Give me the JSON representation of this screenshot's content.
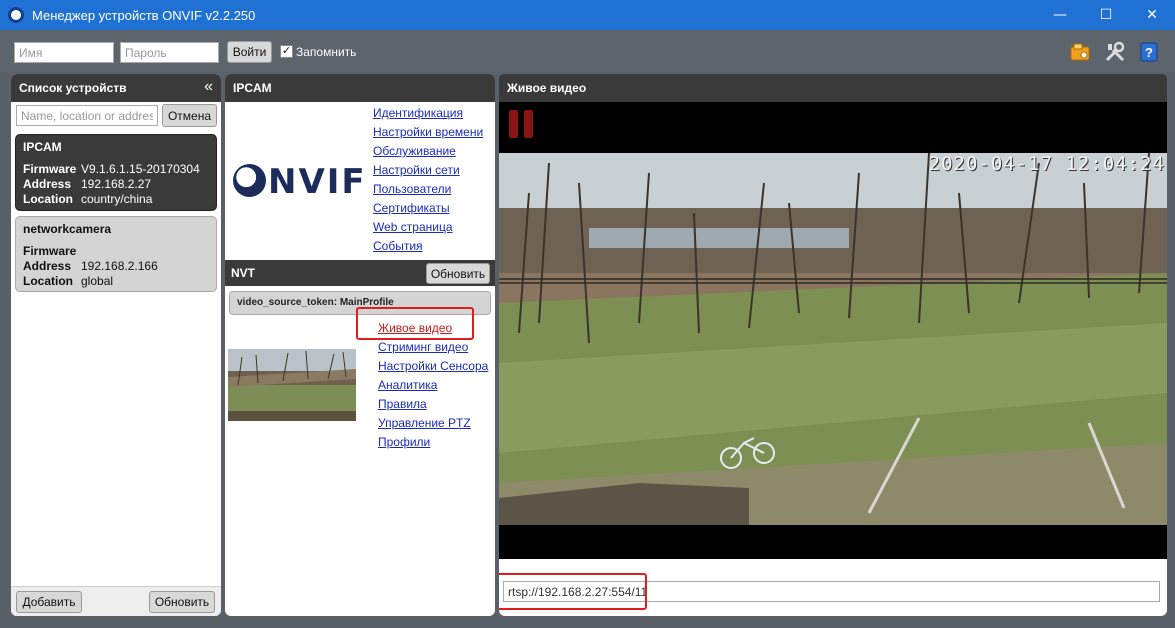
{
  "window": {
    "title": "Менеджер устройств ONVIF v2.2.250",
    "minimize": "—",
    "maximize": "☐",
    "close": "✕"
  },
  "login": {
    "user_placeholder": "Имя",
    "password_placeholder": "Пароль",
    "login_label": "Войти",
    "remember_label": "Запомнить",
    "remember_checked": "✓"
  },
  "devices": {
    "header": "Список устройств",
    "collapse_glyph": "«",
    "search_placeholder": "Name, location or address",
    "cancel_label": "Отмена",
    "items": [
      {
        "name": "IPCAM",
        "firmware_label": "Firmware",
        "firmware": "V9.1.6.1.15-20170304",
        "address_label": "Address",
        "address": "192.168.2.27",
        "location_label": "Location",
        "location": "country/china"
      },
      {
        "name": "networkcamera",
        "firmware_label": "Firmware",
        "firmware": "",
        "address_label": "Address",
        "address": "192.168.2.166",
        "location_label": "Location",
        "location": "global"
      }
    ],
    "add_label": "Добавить",
    "refresh_label": "Обновить"
  },
  "ipcam": {
    "header": "IPCAM",
    "logo_text": "NVIF",
    "links": [
      "Идентификация",
      "Настройки времени",
      "Обслуживание",
      "Настройки сети",
      "Пользователи",
      "Сертификаты",
      "Web страница",
      "События"
    ],
    "nvt_header": "NVT",
    "nvt_refresh": "Обновить",
    "token": "video_source_token: MainProfile",
    "profile_links": [
      "Живое видео",
      "Стриминг видео",
      "Настройки Сенсора",
      "Аналитика",
      "Правила",
      "Управление PTZ",
      "Профили"
    ]
  },
  "video": {
    "header": "Живое видео",
    "timestamp": "2020-04-17 12:04:24",
    "url": "rtsp://192.168.2.27:554/11"
  },
  "colors": {
    "titlebar": "#1f72d4",
    "panel_header": "#3a3a3a",
    "link": "#1a2cb8",
    "highlight": "#e21c1c",
    "pause": "#8a1414"
  }
}
